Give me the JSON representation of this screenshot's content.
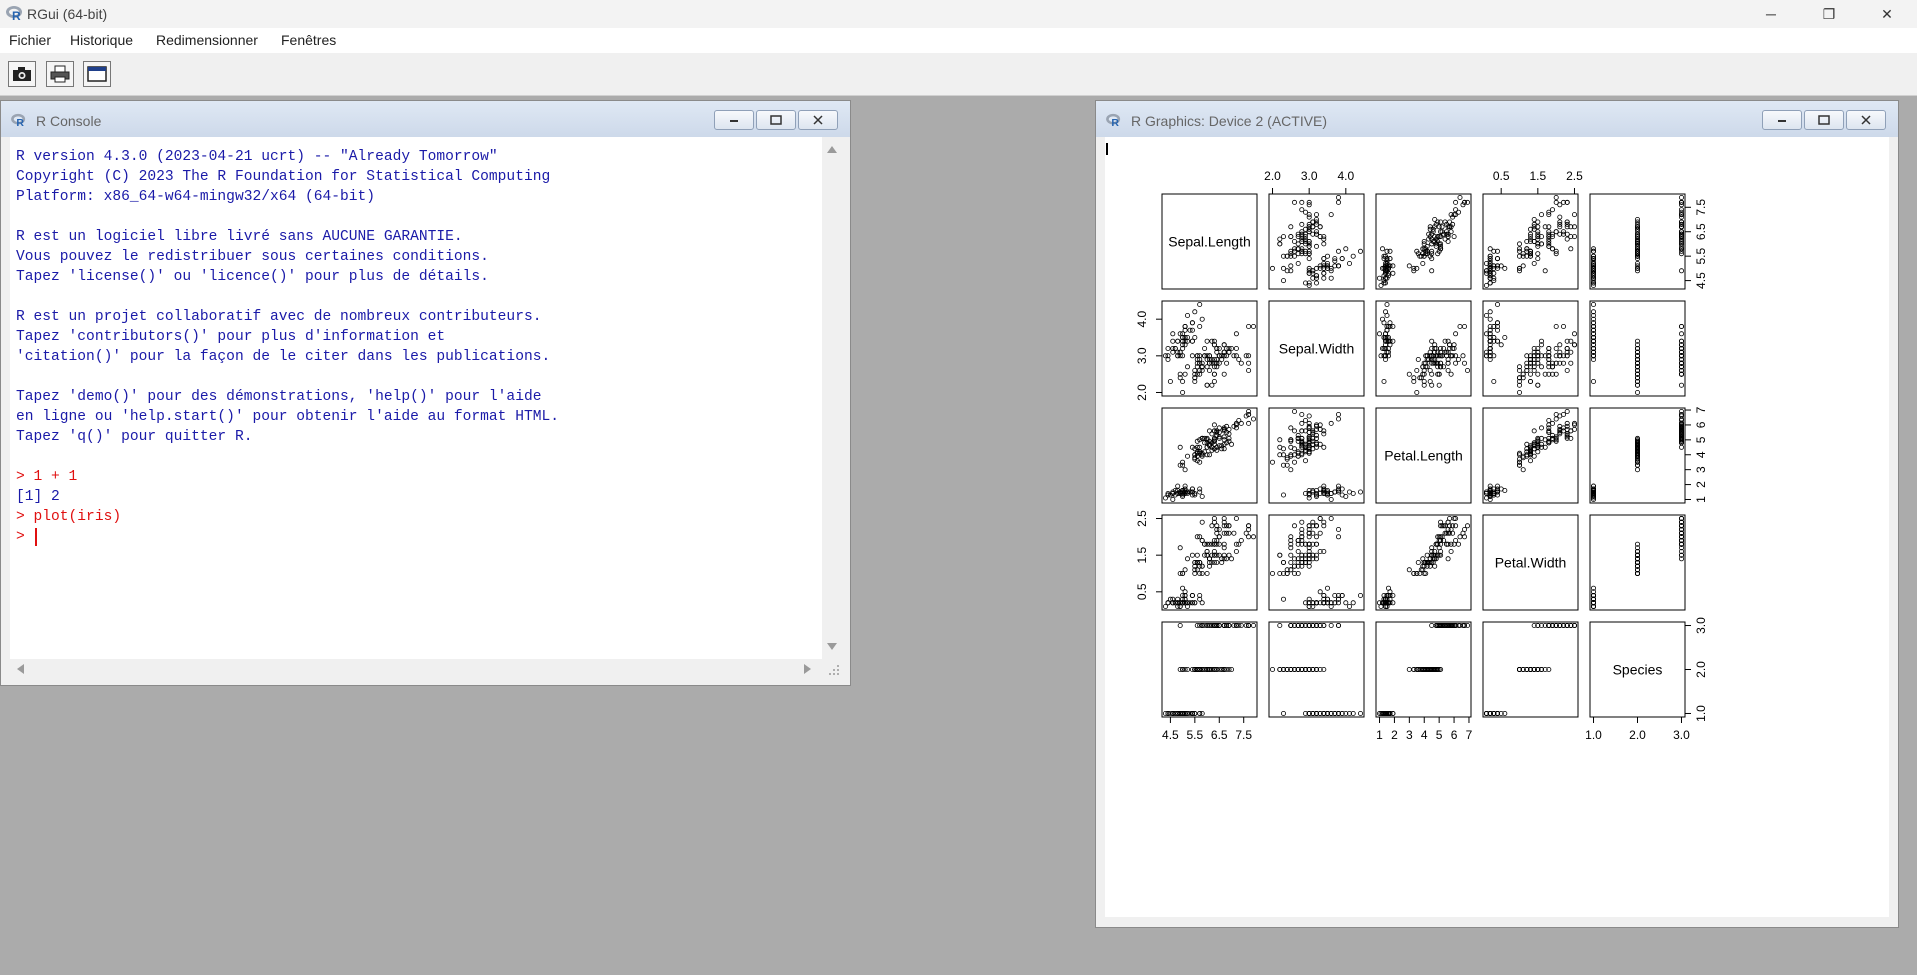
{
  "app": {
    "title": "RGui (64-bit)",
    "controls": {
      "minimize": "─",
      "maximize": "❐",
      "close": "✕"
    }
  },
  "menu": {
    "items": [
      "Fichier",
      "Historique",
      "Redimensionner",
      "Fenêtres"
    ]
  },
  "toolbar": {
    "icons": [
      "camera-icon",
      "print-icon",
      "window-icon"
    ]
  },
  "console": {
    "title": "R Console",
    "lines": [
      {
        "text": "R version 4.3.0 (2023-04-21 ucrt) -- \"Already Tomorrow\"",
        "kind": "output"
      },
      {
        "text": "Copyright (C) 2023 The R Foundation for Statistical Computing",
        "kind": "output"
      },
      {
        "text": "Platform: x86_64-w64-mingw32/x64 (64-bit)",
        "kind": "output"
      },
      {
        "text": "",
        "kind": "output"
      },
      {
        "text": "R est un logiciel libre livré sans AUCUNE GARANTIE.",
        "kind": "output"
      },
      {
        "text": "Vous pouvez le redistribuer sous certaines conditions.",
        "kind": "output"
      },
      {
        "text": "Tapez 'license()' ou 'licence()' pour plus de détails.",
        "kind": "output"
      },
      {
        "text": "",
        "kind": "output"
      },
      {
        "text": "R est un projet collaboratif avec de nombreux contributeurs.",
        "kind": "output"
      },
      {
        "text": "Tapez 'contributors()' pour plus d'information et",
        "kind": "output"
      },
      {
        "text": "'citation()' pour la façon de le citer dans les publications.",
        "kind": "output"
      },
      {
        "text": "",
        "kind": "output"
      },
      {
        "text": "Tapez 'demo()' pour des démonstrations, 'help()' pour l'aide",
        "kind": "output"
      },
      {
        "text": "en ligne ou 'help.start()' pour obtenir l'aide au format HTML.",
        "kind": "output"
      },
      {
        "text": "Tapez 'q()' pour quitter R.",
        "kind": "output"
      },
      {
        "text": "",
        "kind": "output"
      },
      {
        "text": "> 1 + 1",
        "kind": "prompt"
      },
      {
        "text": "[1] 2",
        "kind": "output"
      },
      {
        "text": "> plot(iris)",
        "kind": "prompt"
      },
      {
        "text": "> ",
        "kind": "prompt"
      }
    ]
  },
  "graphics": {
    "title": "R Graphics: Device 2 (ACTIVE)",
    "variables": [
      "Sepal.Length",
      "Sepal.Width",
      "Petal.Length",
      "Petal.Width",
      "Species"
    ],
    "axis_ticks": {
      "Sepal.Length": [
        "4.5",
        "5.5",
        "6.5",
        "7.5"
      ],
      "Sepal.Width": [
        "2.0",
        "3.0",
        "4.0"
      ],
      "Petal.Length": [
        "1",
        "2",
        "3",
        "4",
        "5",
        "6",
        "7"
      ],
      "Petal.Width": [
        "0.5",
        "1.5",
        "2.5"
      ],
      "Species": [
        "1.0",
        "2.0",
        "3.0"
      ]
    },
    "colors": {
      "console_text": "#1a1aa8",
      "prompt_text": "#e01010"
    }
  }
}
